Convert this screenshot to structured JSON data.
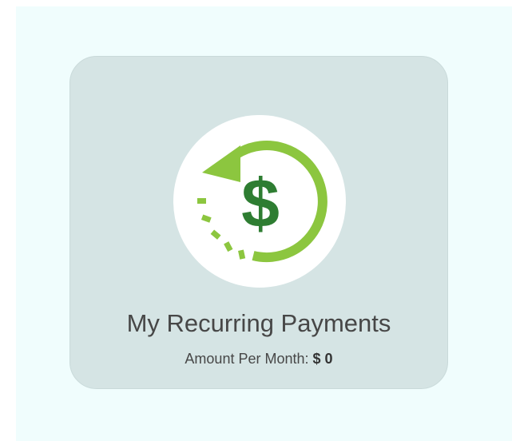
{
  "card": {
    "title": "My Recurring Payments",
    "amount_label": "Amount Per Month:",
    "currency_symbol": "$",
    "amount_value": "0",
    "icon": "recurring-dollar-icon"
  },
  "colors": {
    "page_background": "#f0fdfd",
    "card_background": "#d5e4e4",
    "arrow_green": "#8cc63f",
    "dollar_green": "#2e7d32"
  }
}
